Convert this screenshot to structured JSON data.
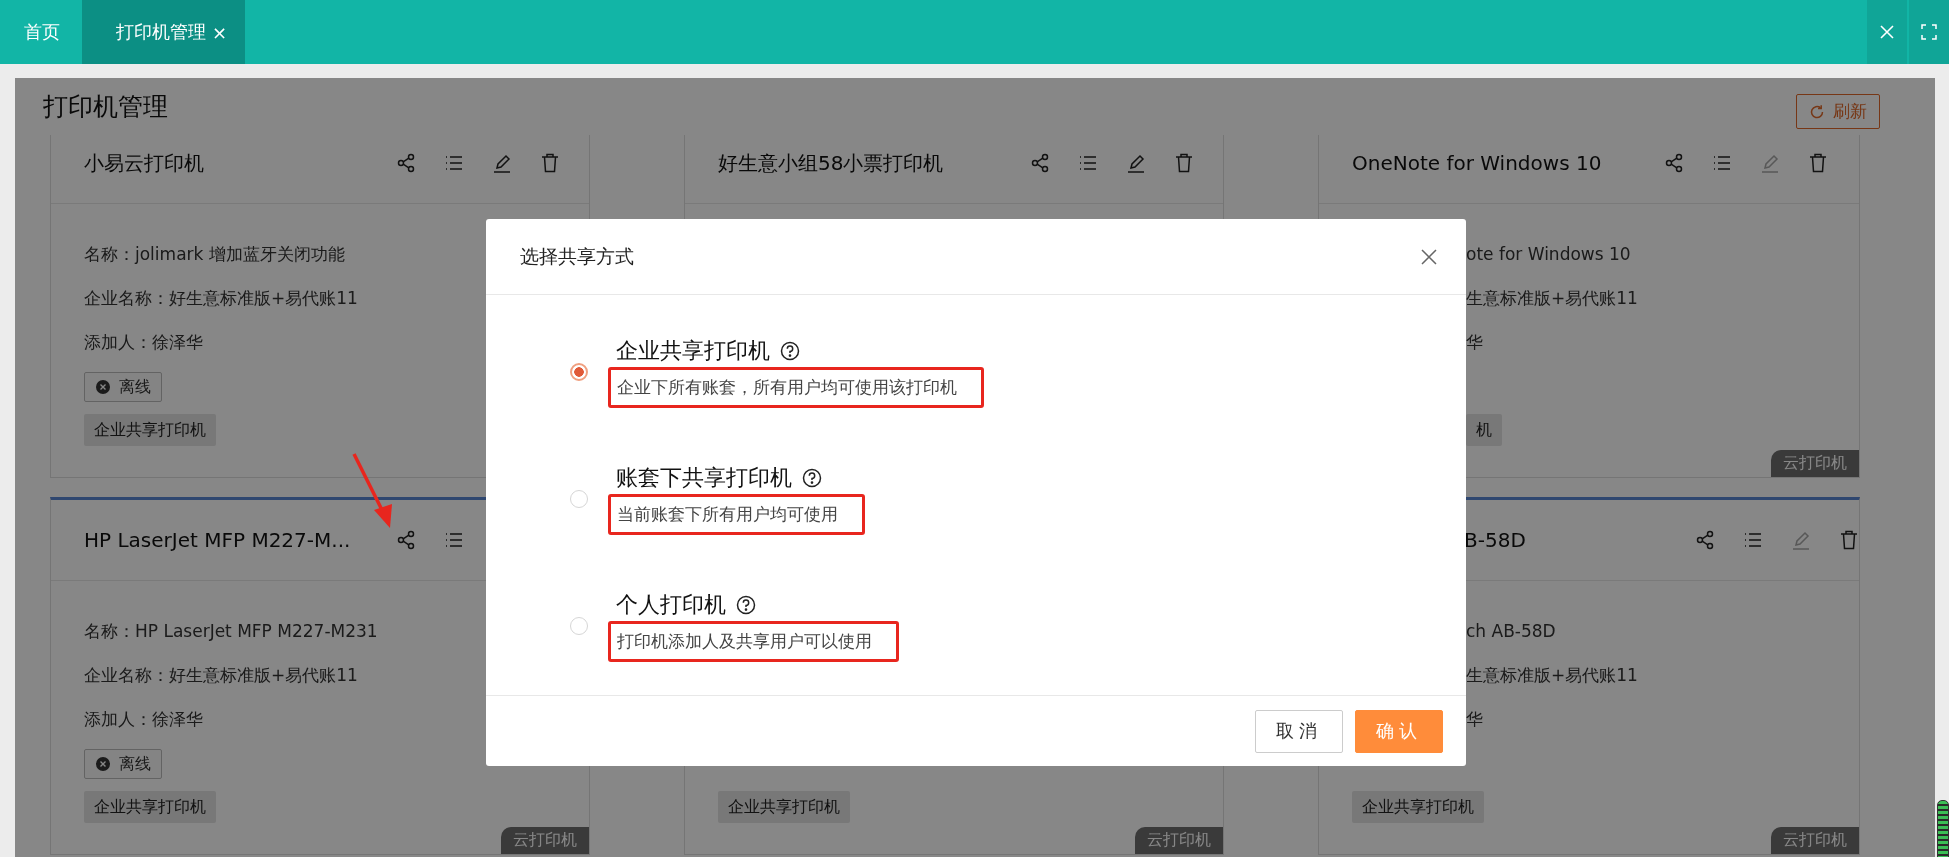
{
  "top_bar": {
    "tabs": [
      {
        "label": "首页",
        "selected": false
      },
      {
        "label": "打印机管理",
        "selected": true,
        "close": "×"
      }
    ]
  },
  "page": {
    "title": "打印机管理",
    "refresh_button": "刷新"
  },
  "cards": [
    {
      "title": "小易云打印机",
      "actions": [
        {
          "kind": "share",
          "disabled": false
        },
        {
          "kind": "list",
          "disabled": false
        },
        {
          "kind": "edit",
          "disabled": false
        },
        {
          "kind": "delete",
          "disabled": false
        }
      ],
      "fields": [
        "名称：jolimark 增加蓝牙关闭功能",
        "企业名称：好生意标准版+易代账11",
        "添加人：徐泽华"
      ],
      "status": "离线",
      "share_type": "企业共享打印机"
    },
    {
      "title": "好生意小组58小票打印机",
      "actions": [
        {
          "kind": "share",
          "disabled": false
        },
        {
          "kind": "list",
          "disabled": false
        },
        {
          "kind": "edit",
          "disabled": false
        },
        {
          "kind": "delete",
          "disabled": false
        }
      ]
    },
    {
      "title": "OneNote for Windows 10",
      "actions": [
        {
          "kind": "share",
          "disabled": false
        },
        {
          "kind": "list",
          "disabled": false
        },
        {
          "kind": "edit",
          "disabled": true
        },
        {
          "kind": "delete",
          "disabled": false
        }
      ],
      "fields": [
        "ote for Windows 10",
        "生意标准版+易代账11",
        "华"
      ],
      "share_type": "机",
      "badge": "云打印机"
    },
    {
      "title": "HP LaserJet MFP M227-M...",
      "actions": [
        {
          "kind": "share",
          "disabled": false
        },
        {
          "kind": "list",
          "disabled": false
        }
      ],
      "fields": [
        "名称：HP LaserJet MFP M227-M231",
        "企业名称：好生意标准版+易代账11",
        "添加人：徐泽华"
      ],
      "status": "离线",
      "share_type": "企业共享打印机",
      "badge": "云打印机"
    },
    {
      "share_type": "企业共享打印机",
      "badge": "云打印机"
    },
    {
      "title": "B-58D",
      "actions": [
        {
          "kind": "share",
          "disabled": false
        },
        {
          "kind": "list",
          "disabled": false
        },
        {
          "kind": "edit",
          "disabled": true
        },
        {
          "kind": "delete",
          "disabled": false
        }
      ],
      "fields": [
        "ch AB-58D",
        "生意标准版+易代账11",
        "华"
      ],
      "share_type": "企业共享打印机",
      "badge": "云打印机"
    }
  ],
  "modal": {
    "title": "选择共享方式",
    "options": [
      {
        "title": "企业共享打印机",
        "description": "企业下所有账套，所有用户均可使用该打印机",
        "selected": true,
        "highlighted": true
      },
      {
        "title": "账套下共享打印机",
        "description": "当前账套下所有用户均可使用",
        "selected": false,
        "highlighted": true
      },
      {
        "title": "个人打印机",
        "description": "打印机添加人及共享用户可以使用",
        "selected": false,
        "highlighted": true
      }
    ],
    "buttons": [
      {
        "label": "取消",
        "kind": "secondary"
      },
      {
        "label": "确认",
        "kind": "primary"
      }
    ]
  },
  "annotation_arrow": true
}
